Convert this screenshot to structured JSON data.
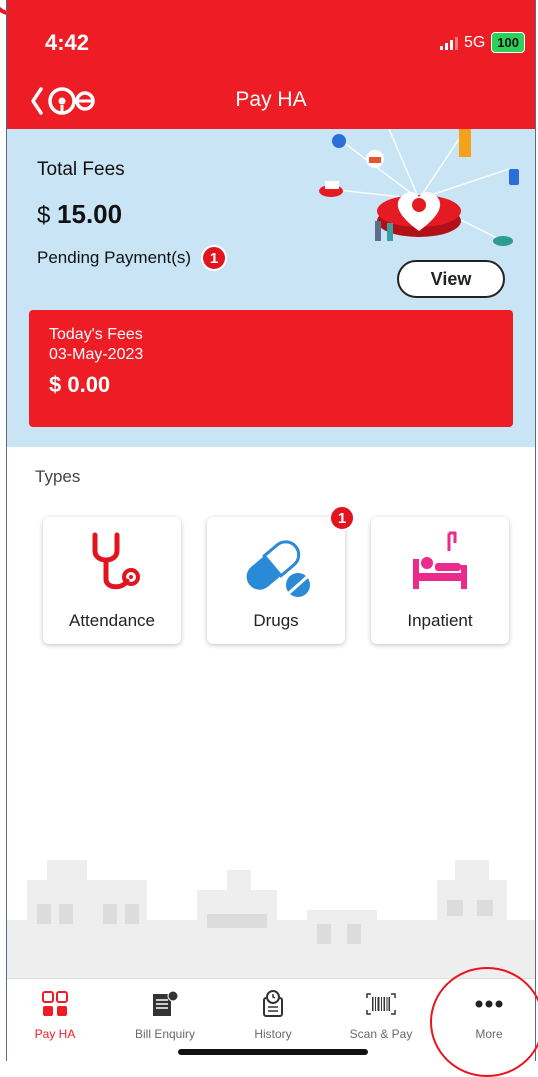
{
  "status_bar": {
    "time": "4:42",
    "network": "5G",
    "battery": "100"
  },
  "header": {
    "title": "Pay HA"
  },
  "summary": {
    "total_fees_label": "Total Fees",
    "currency": "$",
    "total_fees_value": "15.00",
    "pending_label": "Pending Payment(s)",
    "pending_count": "1",
    "view_label": "View"
  },
  "today": {
    "label": "Today's Fees",
    "date": "03-May-2023",
    "amount": "$ 0.00"
  },
  "types": {
    "label": "Types",
    "items": [
      {
        "label": "Attendance",
        "icon": "stethoscope-icon"
      },
      {
        "label": "Drugs",
        "icon": "pill-icon",
        "badge": "1"
      },
      {
        "label": "Inpatient",
        "icon": "hospital-bed-icon"
      }
    ]
  },
  "tabbar": {
    "items": [
      {
        "label": "Pay HA",
        "icon": "grid-icon"
      },
      {
        "label": "Bill Enquiry",
        "icon": "bill-icon"
      },
      {
        "label": "History",
        "icon": "history-icon"
      },
      {
        "label": "Scan & Pay",
        "icon": "barcode-icon"
      },
      {
        "label": "More",
        "icon": "more-icon"
      }
    ]
  },
  "colors": {
    "brand_red": "#ee1c25",
    "summary_bg": "#c9e4f4",
    "pill_blue": "#2a8ad8",
    "inpatient_pink": "#ea2b8c"
  }
}
